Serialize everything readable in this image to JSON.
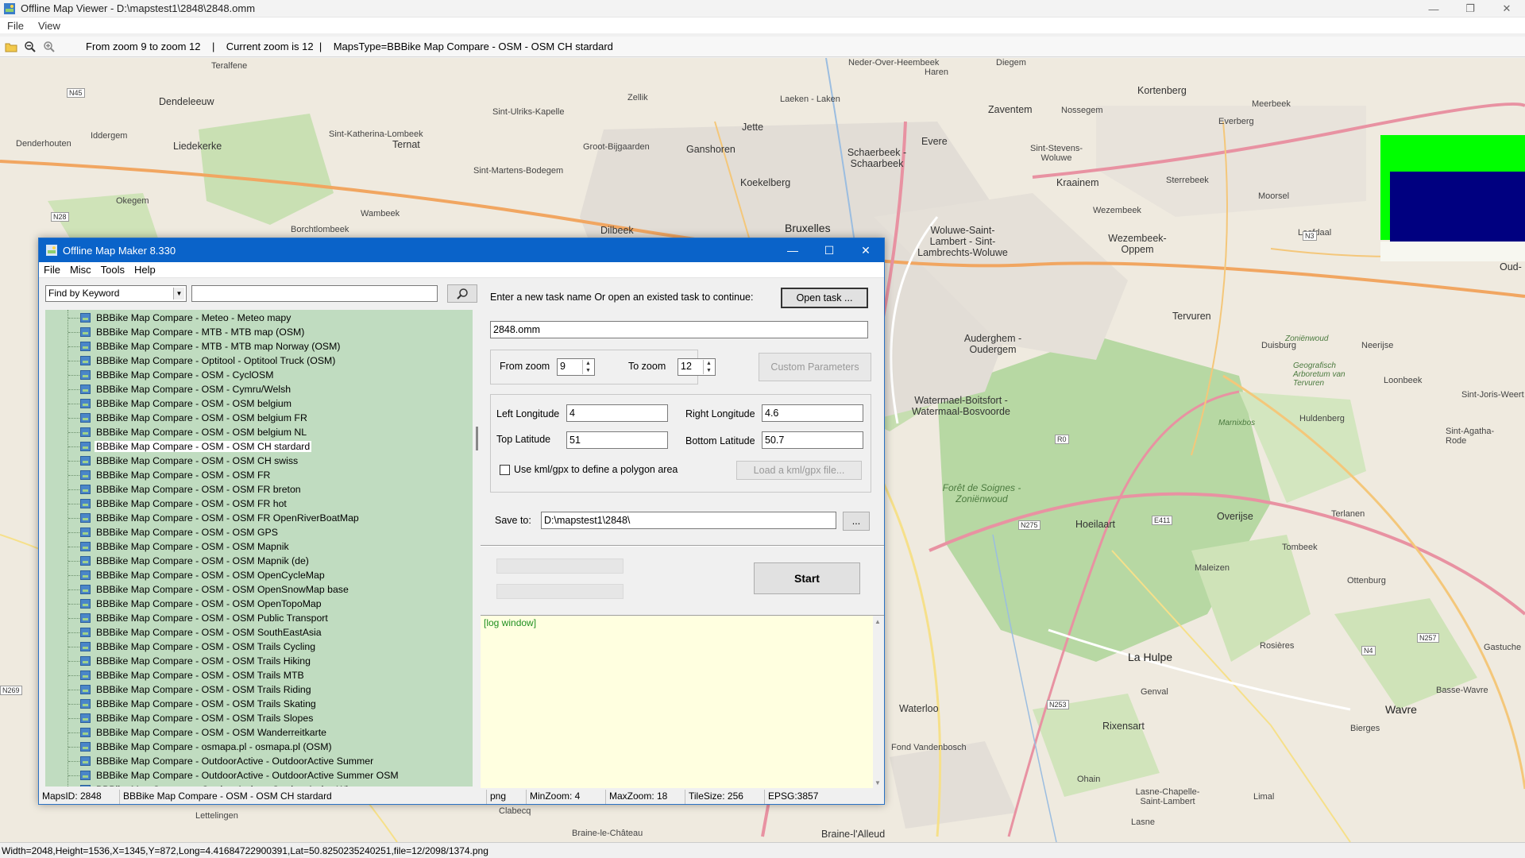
{
  "viewer": {
    "title": "Offline Map Viewer - D:\\mapstest1\\2848\\2848.omm",
    "menu": [
      "File",
      "View"
    ],
    "toolbar_info": {
      "zoom_range": "From zoom 9 to zoom 12",
      "sep1": "|",
      "current_zoom": "Current zoom is 12",
      "sep2": "|",
      "maps_type": "MapsType=BBBike Map Compare - OSM - OSM CH stardard"
    },
    "status": "Width=2048,Height=1536,X=1345,Y=872,Long=4.41684722900391,Lat=50.8250235240251,file=12/2098/1374.png",
    "overlay_colors": {
      "green": "#00ff00",
      "blue": "#000080"
    }
  },
  "map_labels": [
    "Teralfene",
    "Dendeleeuw",
    "Iddergem",
    "Liedekerke",
    "Denderhouten",
    "Okegem",
    "Borchtlombeek",
    "Wambeek",
    "Sint-Katherina-Lombeek",
    "Ternat",
    "Sint-Ulriks-Kapelle",
    "Zellik",
    "Groot-Bijgaarden",
    "Sint-Martens-Bodegem",
    "Dilbeek",
    "Jette",
    "Ganshoren",
    "Koekelberg",
    "Laeken - Laken",
    "Neder-Over-Heembeek",
    "Haren",
    "Diegem",
    "Bruxelles",
    "Schaerbeek - Schaarbeek",
    "Evere",
    "Zaventem",
    "Nossegem",
    "Kortenberg",
    "Meerbeek",
    "Everberg",
    "Sint-Stevens-Woluwe",
    "Kraainem",
    "Sterrebeek",
    "Moorsel",
    "Wezembeek",
    "Wezembeek-Oppem",
    "Leefdaal",
    "Woluwe-Saint-Lambert - Sint-Lambrechts-Woluwe",
    "Tervuren",
    "Auderghem - Oudergem",
    "Duisburg",
    "Neerijse",
    "Watermael-Boitsfort - Watermaal-Bosvoorde",
    "Loonbeek",
    "Huldenberg",
    "Sint-Joris-Weert",
    "Sint-Agatha-Rode",
    "Forêt de Soignes - Zoniënwoud",
    "Hoeilaart",
    "Overijse",
    "Terlanen",
    "Tombeek",
    "Ottenburg",
    "Maleizen",
    "La Hulpe",
    "Rosières",
    "Genval",
    "Waterloo",
    "Wavre",
    "Basse-Wavre",
    "Bierges",
    "Rixensart",
    "Ohain",
    "Fond Vandenbosch",
    "Lasne-Chapelle-Saint-Lambert",
    "Lasne",
    "Limal",
    "Braine-l'Alleud",
    "Braine-le-Château",
    "Clabecq",
    "Lettelingen",
    "Oud-",
    "Gastuche",
    "Geografisch Arboretum van Tervuren",
    "Zoniënwoud",
    "Marnixbos"
  ],
  "dialog": {
    "title": "Offline Map Maker 8.330",
    "menu": [
      "File",
      "Misc",
      "Tools",
      "Help"
    ],
    "search": {
      "mode": "Find by Keyword",
      "query": ""
    },
    "tree_items": [
      "BBBike Map Compare - Meteo - Meteo mapy",
      "BBBike Map Compare - MTB - MTB map (OSM)",
      "BBBike Map Compare - MTB - MTB map Norway (OSM)",
      "BBBike Map Compare - Optitool - Optitool Truck (OSM)",
      "BBBike Map Compare - OSM - CyclOSM",
      "BBBike Map Compare - OSM - Cymru/Welsh",
      "BBBike Map Compare - OSM - OSM belgium",
      "BBBike Map Compare - OSM - OSM belgium FR",
      "BBBike Map Compare - OSM - OSM belgium NL",
      "BBBike Map Compare - OSM - OSM CH stardard",
      "BBBike Map Compare - OSM - OSM CH swiss",
      "BBBike Map Compare - OSM - OSM FR",
      "BBBike Map Compare - OSM - OSM FR breton",
      "BBBike Map Compare - OSM - OSM FR hot",
      "BBBike Map Compare - OSM - OSM FR OpenRiverBoatMap",
      "BBBike Map Compare - OSM - OSM GPS",
      "BBBike Map Compare - OSM - OSM Mapnik",
      "BBBike Map Compare - OSM - OSM Mapnik (de)",
      "BBBike Map Compare - OSM - OSM OpenCycleMap",
      "BBBike Map Compare - OSM - OSM OpenSnowMap base",
      "BBBike Map Compare - OSM - OSM OpenTopoMap",
      "BBBike Map Compare - OSM - OSM Public Transport",
      "BBBike Map Compare - OSM - OSM SouthEastAsia",
      "BBBike Map Compare - OSM - OSM Trails Cycling",
      "BBBike Map Compare - OSM - OSM Trails Hiking",
      "BBBike Map Compare - OSM - OSM Trails MTB",
      "BBBike Map Compare - OSM - OSM Trails Riding",
      "BBBike Map Compare - OSM - OSM Trails Skating",
      "BBBike Map Compare - OSM - OSM Trails Slopes",
      "BBBike Map Compare - OSM - OSM Wanderreitkarte",
      "BBBike Map Compare - osmapa.pl - osmapa.pl (OSM)",
      "BBBike Map Compare - OutdoorActive - OutdoorActive Summer",
      "BBBike Map Compare - OutdoorActive - OutdoorActive Summer OSM",
      "BBBike Map Compare - OutdoorActive - OutdoorActive Winter"
    ],
    "selected_index": 9,
    "task_prompt": "Enter a new task name Or open an existed task to continue:",
    "open_task_label": "Open task ...",
    "task_name": "2848.omm",
    "from_zoom_label": "From zoom",
    "from_zoom": "9",
    "to_zoom_label": "To zoom",
    "to_zoom": "12",
    "custom_params_label": "Custom Parameters",
    "left_lon_label": "Left Longitude",
    "left_lon": "4",
    "right_lon_label": "Right Longitude",
    "right_lon": "4.6",
    "top_lat_label": "Top Latitude",
    "top_lat": "51",
    "bottom_lat_label": "Bottom Latitude",
    "bottom_lat": "50.7",
    "kml_label": "Use kml/gpx to define a polygon area",
    "load_kml_label": "Load a kml/gpx file...",
    "save_to_label": "Save to:",
    "save_to": "D:\\mapstest1\\2848\\",
    "browse_label": "...",
    "start_label": "Start",
    "log_text": "[log window]",
    "status": {
      "maps_id": "MapsID: 2848",
      "map_name": "BBBike Map Compare - OSM - OSM CH stardard",
      "format": "png",
      "min_zoom": "MinZoom: 4",
      "max_zoom": "MaxZoom: 18",
      "tile_size": "TileSize: 256",
      "epsg": "EPSG:3857"
    }
  }
}
